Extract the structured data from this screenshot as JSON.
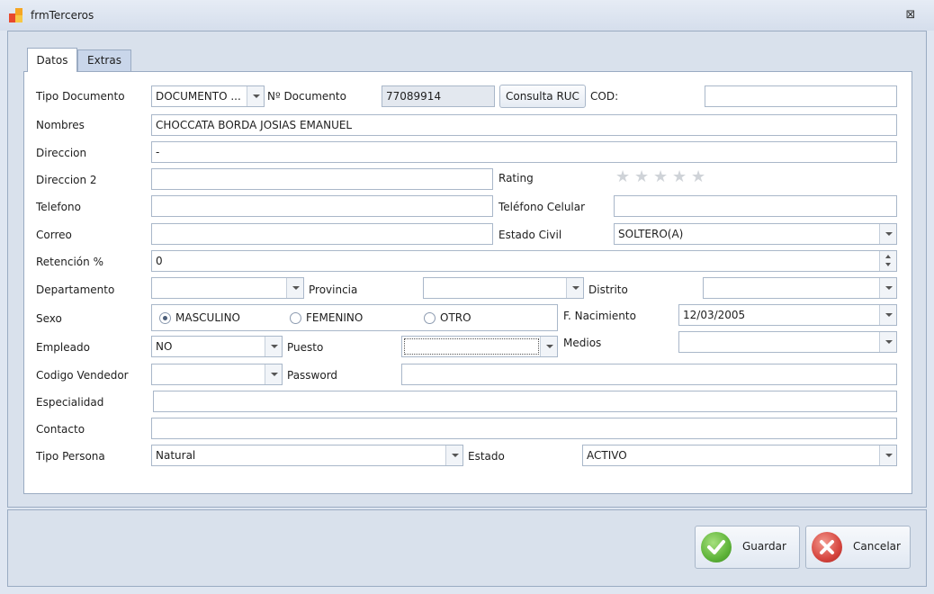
{
  "window": {
    "title": "frmTerceros",
    "close_glyph": "⊠"
  },
  "tabs": [
    {
      "label": "Datos"
    },
    {
      "label": "Extras"
    }
  ],
  "form": {
    "tipo_documento": {
      "label": "Tipo Documento",
      "value": "DOCUMENTO ..."
    },
    "numero_documento": {
      "label": "Nº Documento",
      "value": "77089914"
    },
    "consulta_ruc": {
      "label": "Consulta RUC"
    },
    "cod": {
      "label": "COD:",
      "value": ""
    },
    "nombres": {
      "label": "Nombres",
      "value": "CHOCCATA BORDA JOSIAS EMANUEL"
    },
    "direccion": {
      "label": "Direccion",
      "value": "-"
    },
    "direccion2": {
      "label": "Direccion 2",
      "value": ""
    },
    "rating": {
      "label": "Rating",
      "value": 0,
      "max": 5
    },
    "telefono": {
      "label": "Telefono",
      "value": ""
    },
    "telefono_celular": {
      "label": "Teléfono Celular",
      "value": ""
    },
    "correo": {
      "label": "Correo",
      "value": ""
    },
    "estado_civil": {
      "label": "Estado Civil",
      "value": "SOLTERO(A)"
    },
    "retencion": {
      "label": "Retención %",
      "value": "0"
    },
    "departamento": {
      "label": "Departamento",
      "value": ""
    },
    "provincia": {
      "label": "Provincia",
      "value": ""
    },
    "distrito": {
      "label": "Distrito",
      "value": ""
    },
    "sexo": {
      "label": "Sexo",
      "options": [
        "MASCULINO",
        "FEMENINO",
        "OTRO"
      ],
      "selected": "MASCULINO"
    },
    "f_nacimiento": {
      "label": "F. Nacimiento",
      "value": "12/03/2005"
    },
    "empleado": {
      "label": "Empleado",
      "value": "NO"
    },
    "puesto": {
      "label": "Puesto",
      "value": ""
    },
    "medios": {
      "label": "Medios",
      "value": ""
    },
    "codigo_vendedor": {
      "label": "Codigo Vendedor",
      "value": ""
    },
    "password": {
      "label": "Password",
      "value": ""
    },
    "especialidad": {
      "label": "Especialidad",
      "value": ""
    },
    "contacto": {
      "label": "Contacto",
      "value": ""
    },
    "tipo_persona": {
      "label": "Tipo Persona",
      "value": "Natural"
    },
    "estado": {
      "label": "Estado",
      "value": "ACTIVO"
    }
  },
  "actions": {
    "guardar": "Guardar",
    "cancelar": "Cancelar"
  },
  "colors": {
    "accent_green": "#5fb43a",
    "accent_red": "#d6463f",
    "panel": "#d9e1ec"
  }
}
